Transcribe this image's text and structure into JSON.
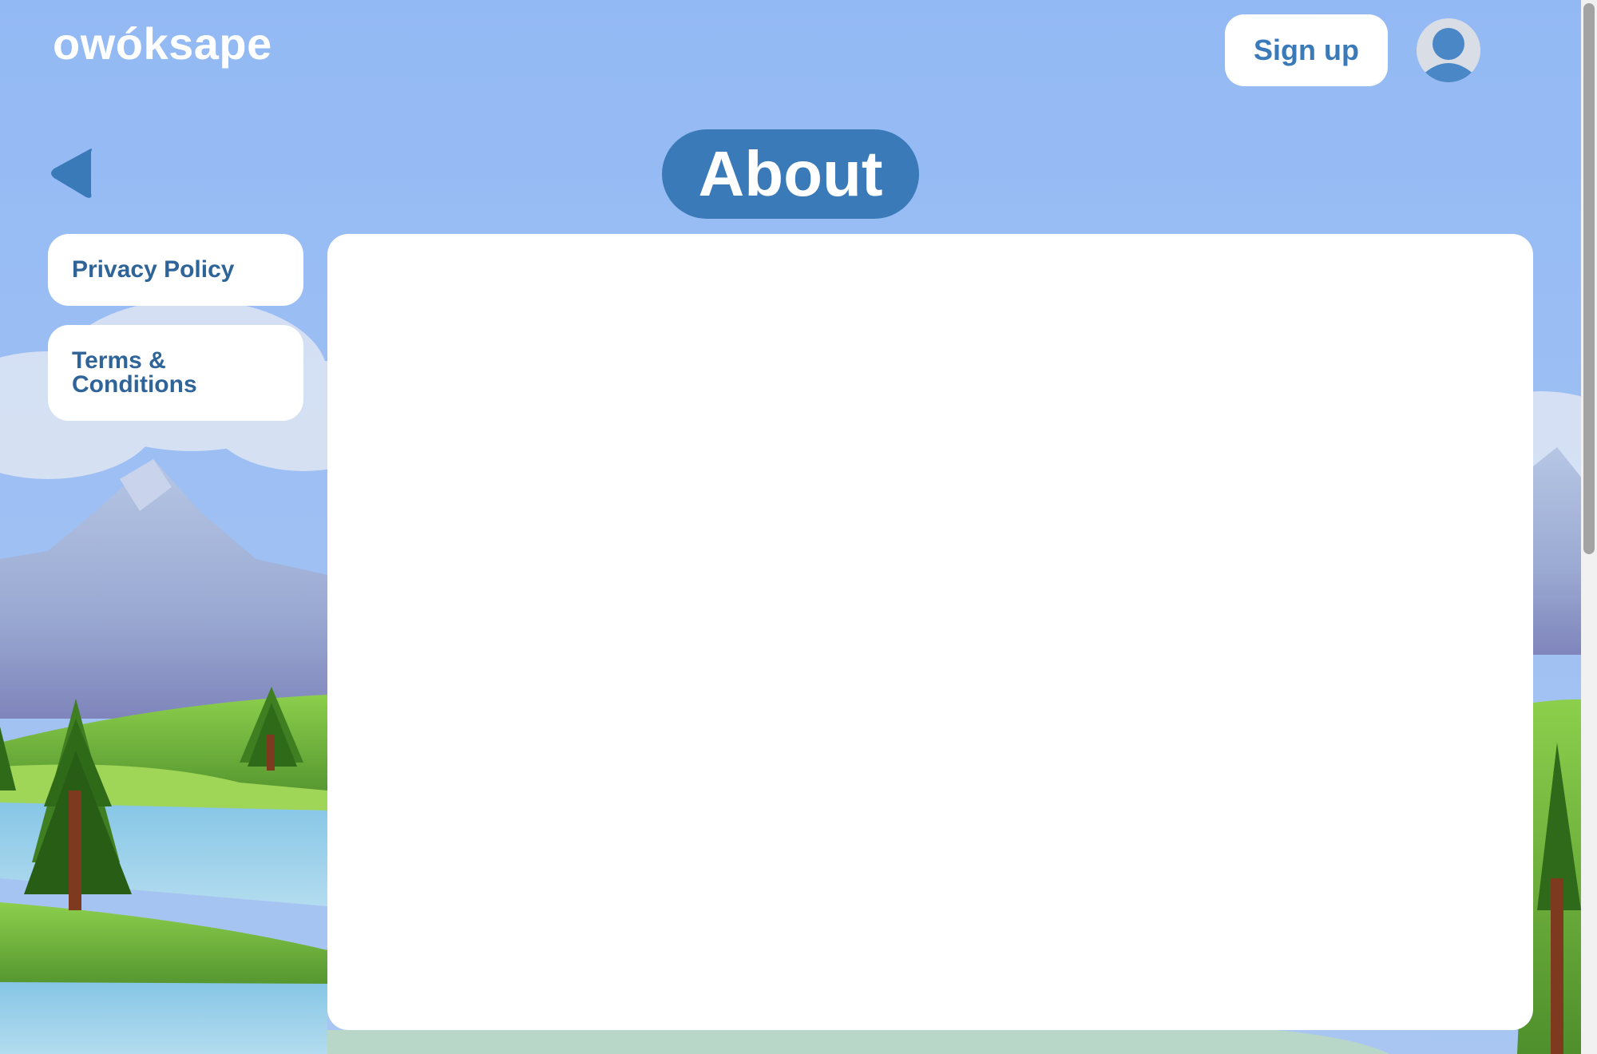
{
  "header": {
    "logo_text": "owóksape",
    "signup_label": "Sign up",
    "avatar_icon": "user-avatar-icon"
  },
  "page": {
    "back_icon": "back-arrow-icon",
    "title": "About"
  },
  "sidebar": {
    "items": [
      {
        "label": "Privacy Policy"
      },
      {
        "label": "Terms & Conditions"
      }
    ]
  },
  "content": {
    "text": ""
  },
  "colors": {
    "sky": "#93b9f4",
    "accent": "#3a7ab9",
    "button_text": "#2f6498",
    "panel": "#ffffff"
  }
}
